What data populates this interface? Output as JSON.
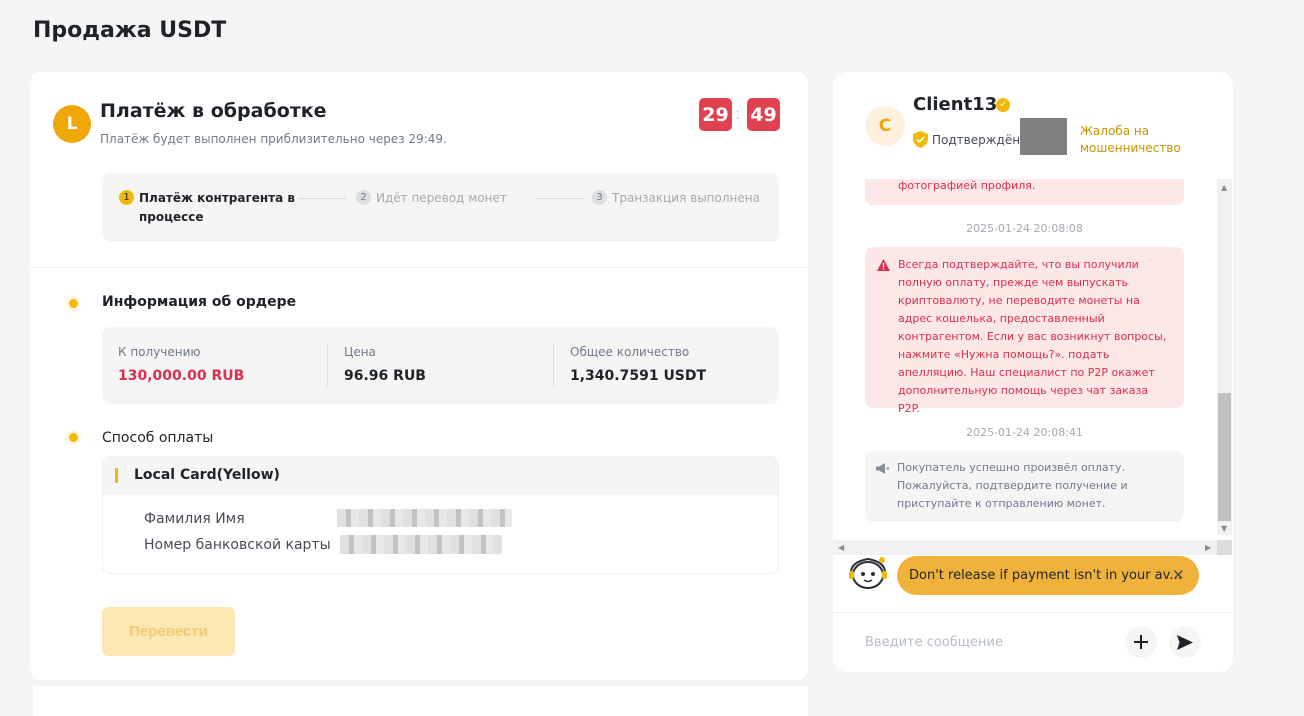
{
  "page": {
    "title": "Продажа USDT"
  },
  "status": {
    "avatar_letter": "L",
    "title": "Платёж в обработке",
    "subtitle": "Платёж будет выполнен приблизительно через 29:49.",
    "timer_minutes": "29",
    "timer_seconds": "49",
    "timer_separator": ":"
  },
  "steps": [
    {
      "num": "1",
      "label_line1": "Платёж контрагента в",
      "label_line2": "процессе",
      "active": true
    },
    {
      "num": "2",
      "label": "Идёт перевод монет",
      "active": false
    },
    {
      "num": "3",
      "label": "Транзакция выполнена",
      "active": false
    }
  ],
  "order_info": {
    "title": "Информация об ордере",
    "items": [
      {
        "label": "К получению",
        "value": "130,000.00 RUB",
        "color": "#d9304e"
      },
      {
        "label": "Цена",
        "value": "96.96 RUB",
        "color": "#1e2329"
      },
      {
        "label": "Общее количество",
        "value": "1,340.7591 USDT",
        "color": "#1e2329"
      }
    ]
  },
  "payment": {
    "title": "Способ оплаты",
    "method": "Local Card(Yellow)",
    "fields": [
      {
        "label": "Фамилия Имя"
      },
      {
        "label": "Номер банковской карты"
      }
    ]
  },
  "transfer_button": "Перевести",
  "chat": {
    "avatar_letter": "C",
    "name": "Client13",
    "confirmed_label": "Подтверждён :",
    "fraud_link_line1": "Жалоба на",
    "fraud_link_line2": "мошенничество",
    "partial_message": "фотографией профиля.",
    "timestamp1": "2025-01-24 20:08:08",
    "warning_message": "Всегда подтверждайте, что вы получили полную оплату, прежде чем выпускать криптовалюту, не переводите монеты на адрес кошелька, предоставленный контрагентом. Если у вас возникнут вопросы, нажмите «Нужна помощь?». подать апелляцию. Наш специалист по P2P окажет дополнительную помощь через чат заказа P2P.",
    "timestamp2": "2025-01-24 20:08:41",
    "info_message": "Покупатель успешно произвёл оплату. Пожалуйста, подтвердите получение и приступайте к отправлению монет.",
    "banner_text": "Don't release if payment isn't in your av...",
    "input_placeholder": "Введите сообщение"
  },
  "icons": {
    "verified": "verified-badge-icon",
    "shield": "shield-check-icon",
    "warning": "warning-triangle-icon",
    "megaphone": "megaphone-icon",
    "bot": "support-bot-icon",
    "close": "close-icon",
    "plus": "plus-icon",
    "send": "send-icon"
  },
  "colors": {
    "accent": "#f0b90b",
    "timer": "#e0414f",
    "negative": "#d9304e",
    "link": "#c99400"
  }
}
